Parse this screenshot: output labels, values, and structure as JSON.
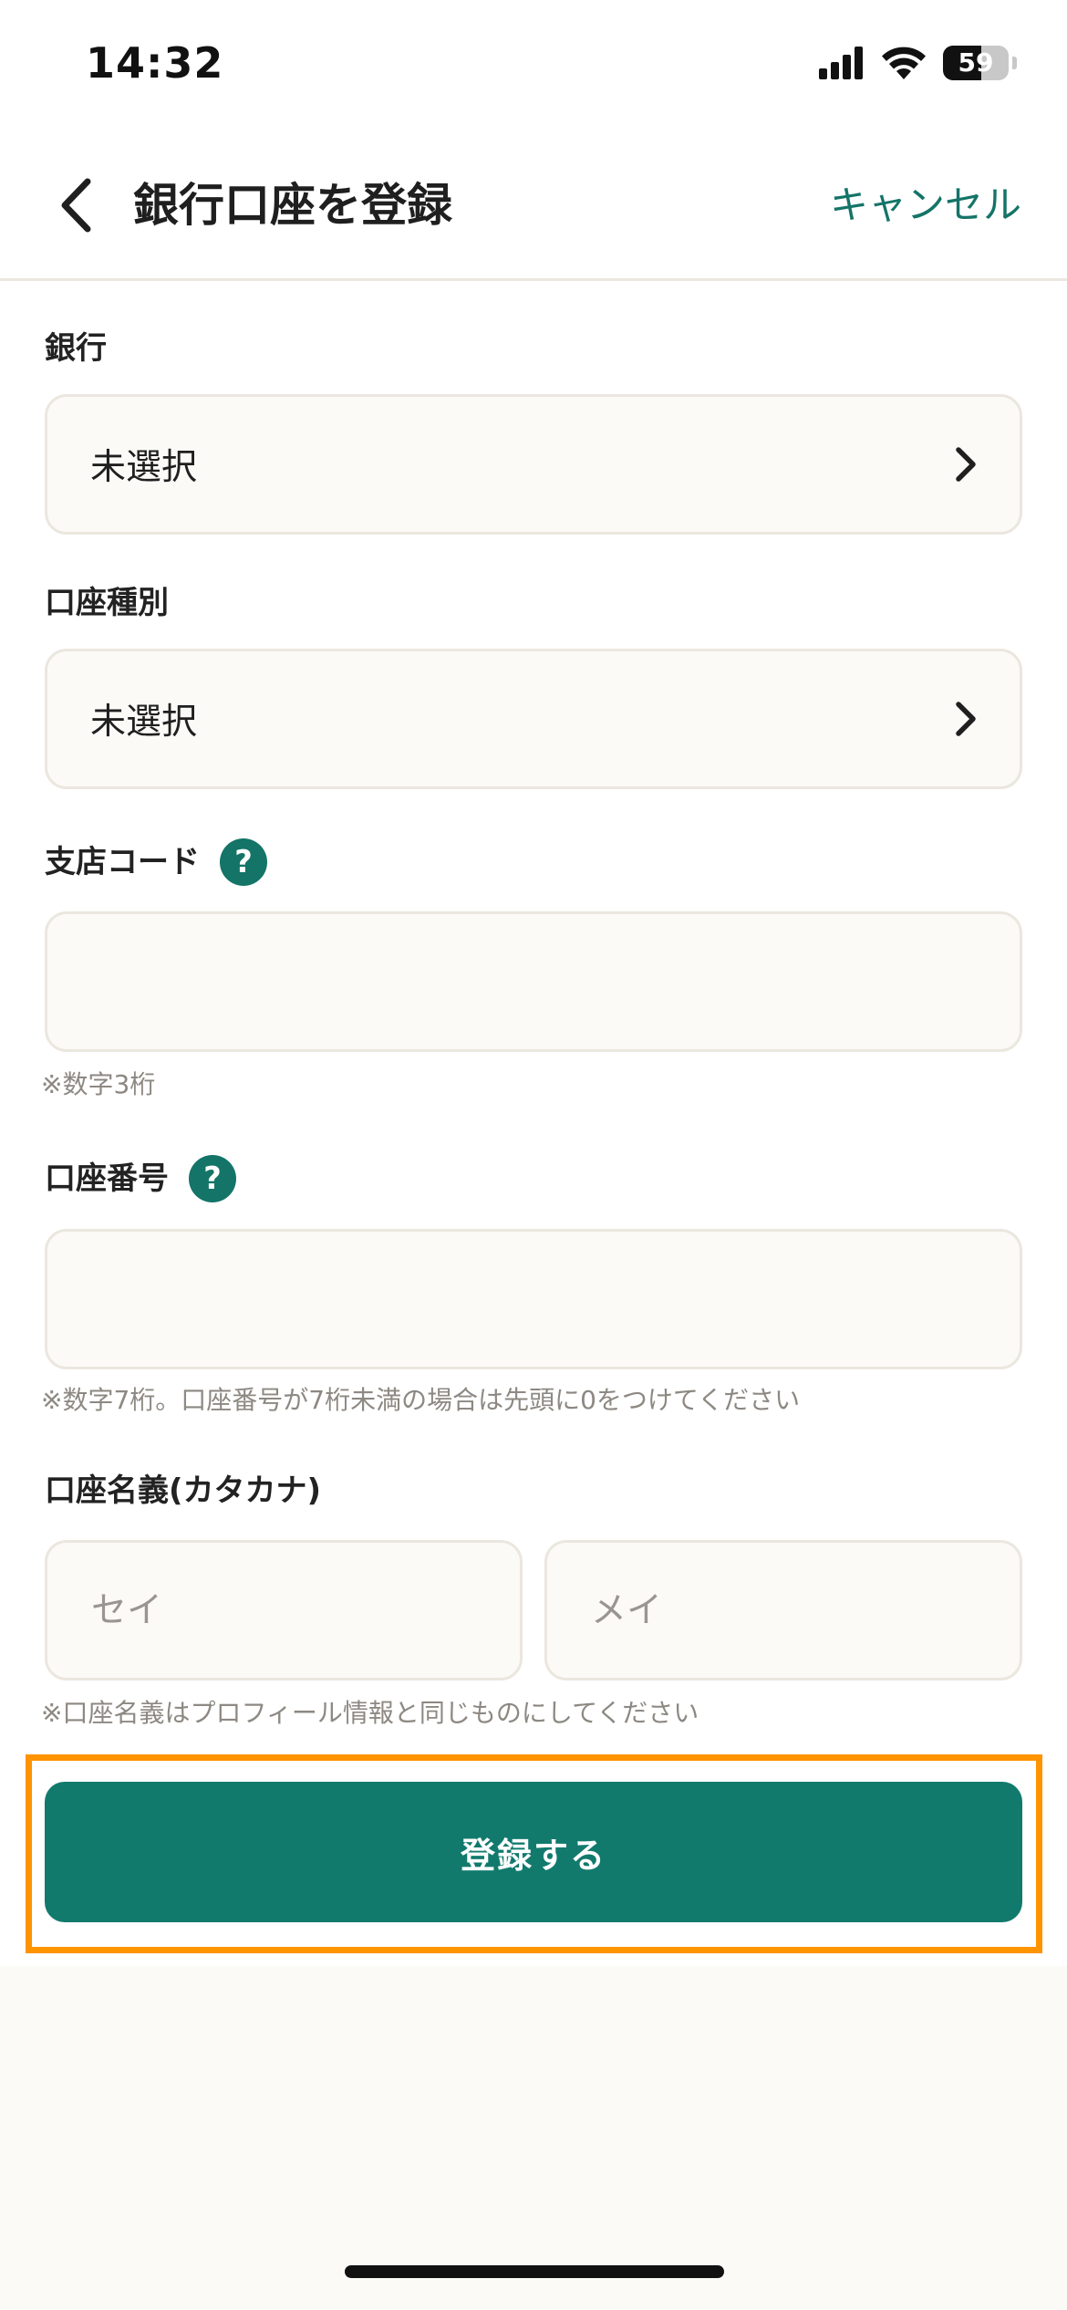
{
  "status_bar": {
    "time": "14:32",
    "battery": "59"
  },
  "nav": {
    "title": "銀行口座を登録",
    "cancel_label": "キャンセル"
  },
  "form": {
    "bank": {
      "label": "銀行",
      "value": "未選択"
    },
    "account_type": {
      "label": "口座種別",
      "value": "未選択"
    },
    "branch_code": {
      "label": "支店コード",
      "help": "?",
      "value": "",
      "placeholder": "",
      "hint": "※数字3桁"
    },
    "account_number": {
      "label": "口座番号",
      "help": "?",
      "value": "",
      "placeholder": "",
      "hint": "※数字7桁。口座番号が7桁未満の場合は先頭に0をつけてください"
    },
    "account_name": {
      "label": "口座名義(カタカナ)",
      "sei_placeholder": "セイ",
      "mei_placeholder": "メイ",
      "hint": "※口座名義はプロフィール情報と同じものにしてください"
    },
    "submit_label": "登録する"
  },
  "colors": {
    "accent": "#147468",
    "button": "#117a6d",
    "highlight": "#ff9300"
  }
}
